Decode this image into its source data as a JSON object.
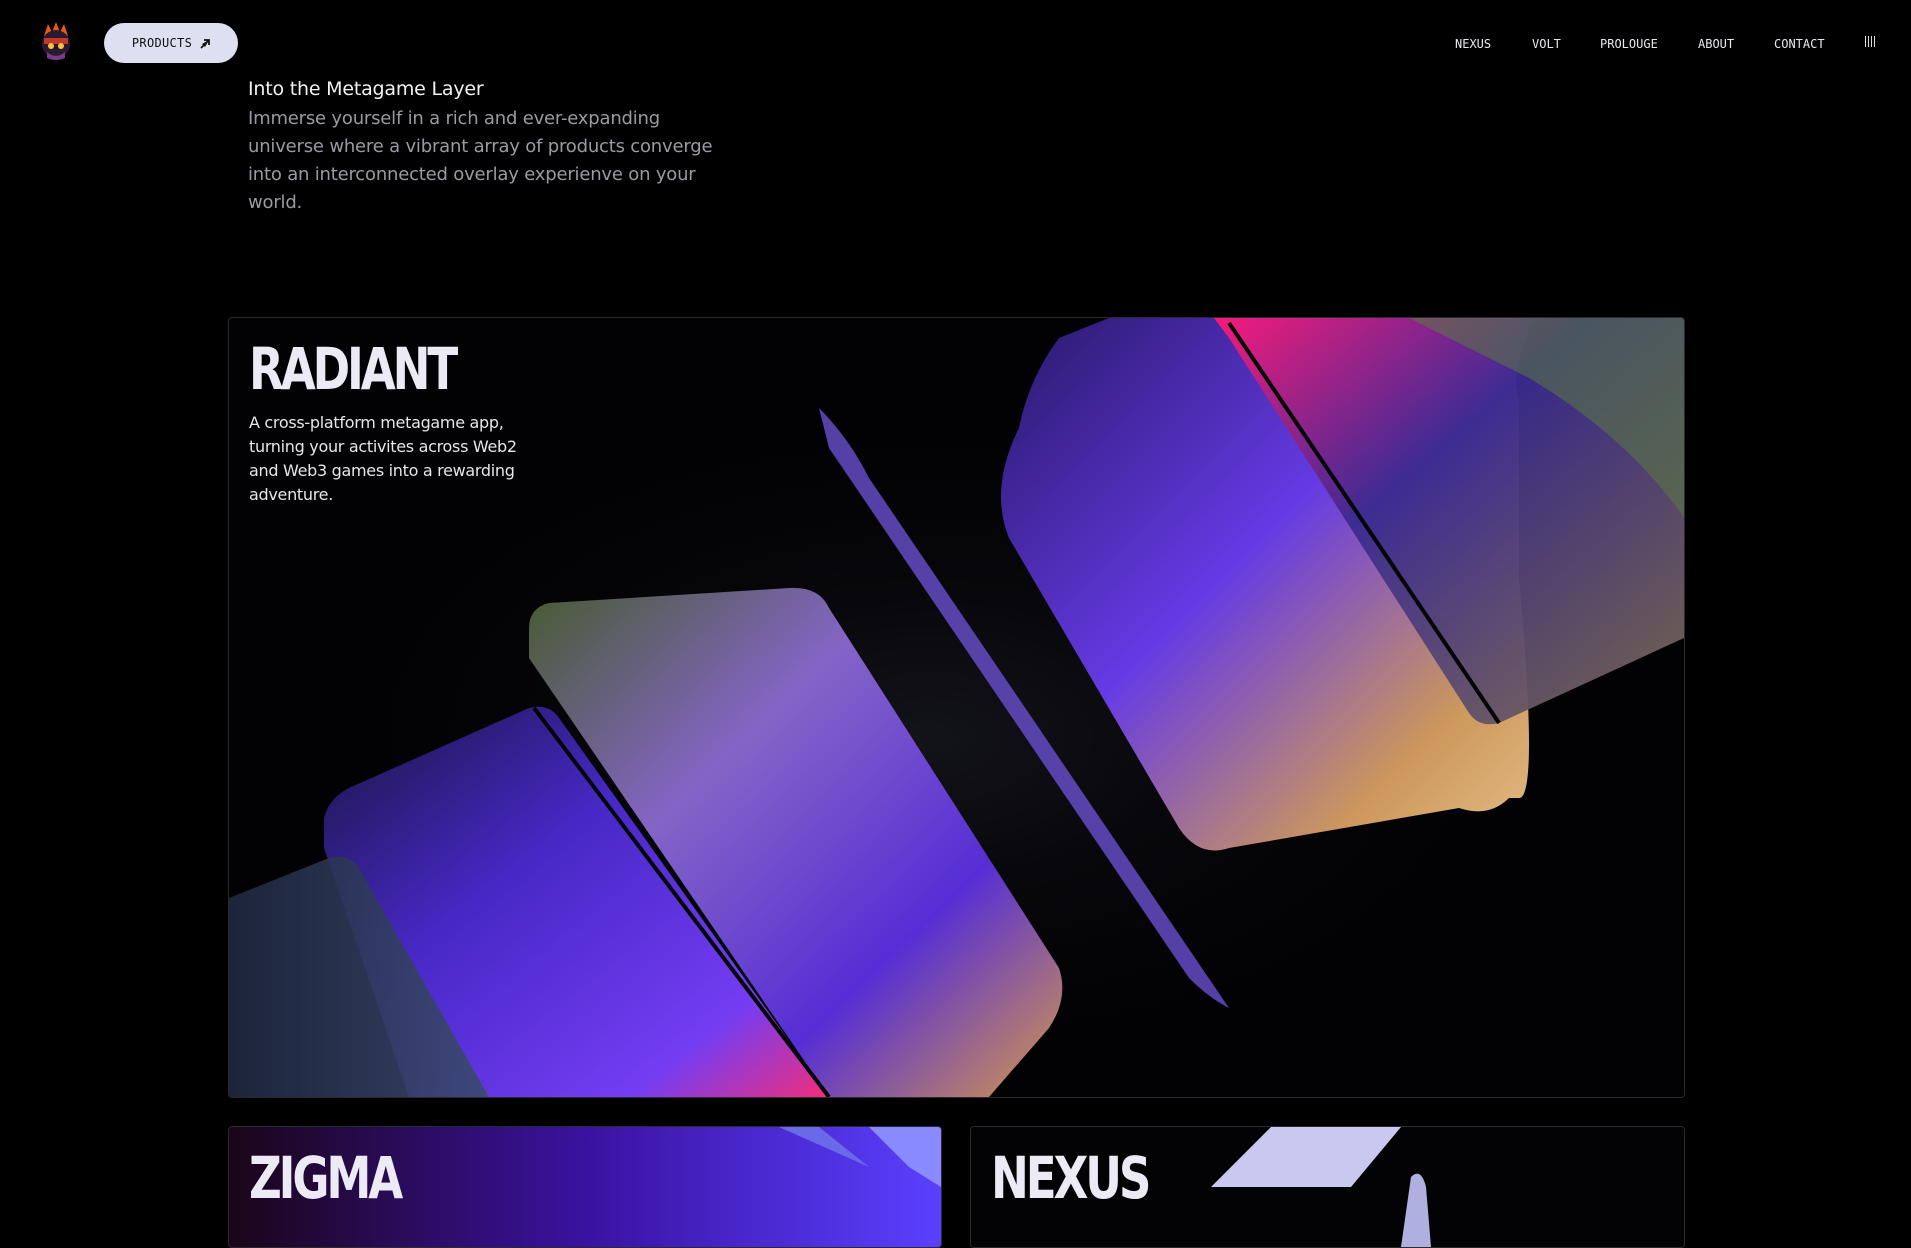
{
  "header": {
    "logo_icon": "ninja-avatar-logo-icon",
    "products_label": "PRODUCTS",
    "products_icon": "arrow-upright-icon",
    "nav": [
      {
        "label": "NEXUS"
      },
      {
        "label": "VOLT"
      },
      {
        "label": "PROLOUGE"
      },
      {
        "label": "ABOUT"
      },
      {
        "label": "CONTACT"
      }
    ],
    "menu_icon": "bars-menu-icon"
  },
  "intro": {
    "title": "Into the Metagame Layer",
    "text": "Immerse yourself in a rich and ever-expanding universe where a vibrant array of products converge into an interconnected overlay experienve on your world."
  },
  "cards": [
    {
      "title": "RADIANT",
      "description": "A cross-platform metagame app, turning your activites across Web2 and Web3 games into a rewarding adventure."
    },
    {
      "title": "ZIGMA"
    },
    {
      "title": "NEXUS"
    }
  ],
  "colors": {
    "background": "#000000",
    "button_bg": "#dfdff2",
    "accent_purple": "#6a3df0",
    "accent_pink": "#ff2d8a"
  }
}
